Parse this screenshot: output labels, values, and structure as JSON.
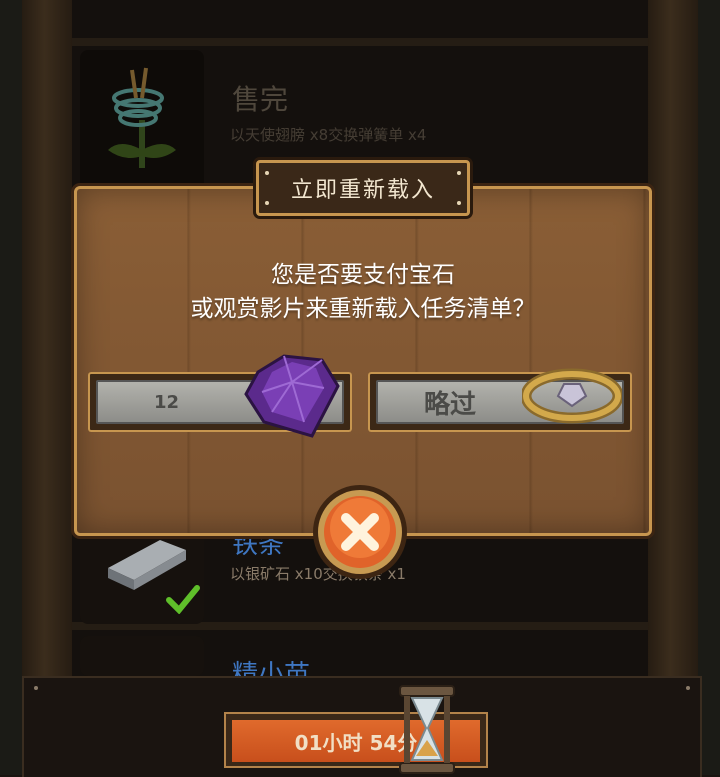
{
  "dialog": {
    "title": "立即重新载入",
    "message_line1": "您是否要支付宝石",
    "message_line2": "或观赏影片来重新载入任务清单？",
    "pay_button_cost": "12",
    "skip_button_label": "略过"
  },
  "list": {
    "row1": {
      "title": "售完",
      "desc": "以天使翅膀 x8交换弹簧单 x4"
    },
    "row2": {
      "title": "铁条",
      "desc": "以银矿石 x10交换铁条 x1"
    },
    "row3": {
      "title": "精小苗"
    }
  },
  "timer": {
    "label": "01小时 54分"
  },
  "icons": {
    "gem": "purple-gem-icon",
    "ring": "gold-ring-icon",
    "close": "close-icon",
    "check": "green-check-icon",
    "hourglass": "hourglass-icon"
  }
}
